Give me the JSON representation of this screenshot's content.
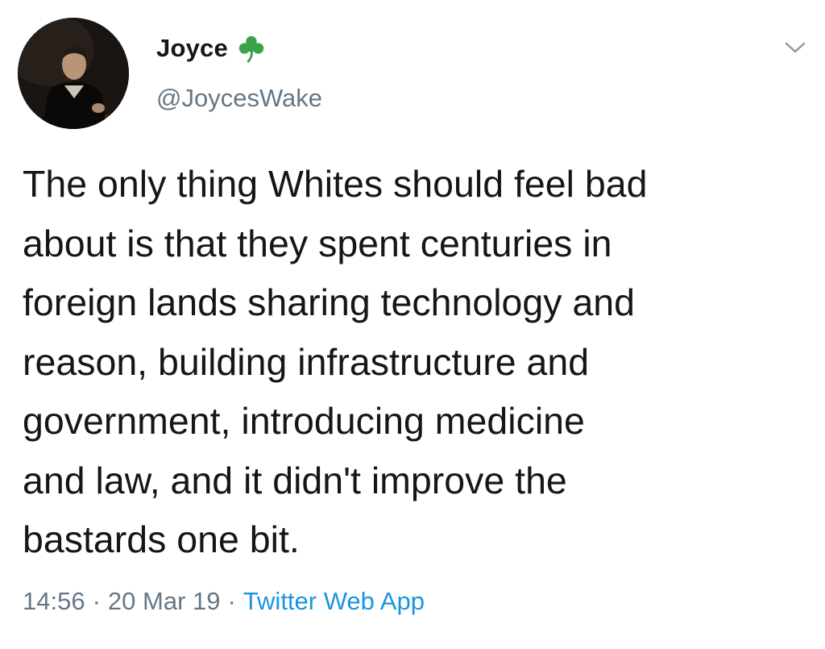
{
  "tweet": {
    "author": {
      "display_name": "Joyce",
      "handle": "@JoycesWake",
      "name_emoji_icon": "shamrock-icon",
      "avatar_icon": "portrait-avatar"
    },
    "text": "The only thing Whites should feel bad\nabout is that they spent centuries in\nforeign lands sharing technology and\nreason, building infrastructure and\ngovernment, introducing medicine\nand law, and it didn't improve the\nbastards one bit.",
    "time": "14:56",
    "separator": "·",
    "date": "20 Mar 19",
    "source": "Twitter Web App",
    "menu_icon": "chevron-down-icon"
  },
  "colors": {
    "text_primary": "#14171a",
    "text_secondary": "#657786",
    "link": "#1b95e0",
    "shamrock": "#3aa34a",
    "background": "#ffffff"
  }
}
